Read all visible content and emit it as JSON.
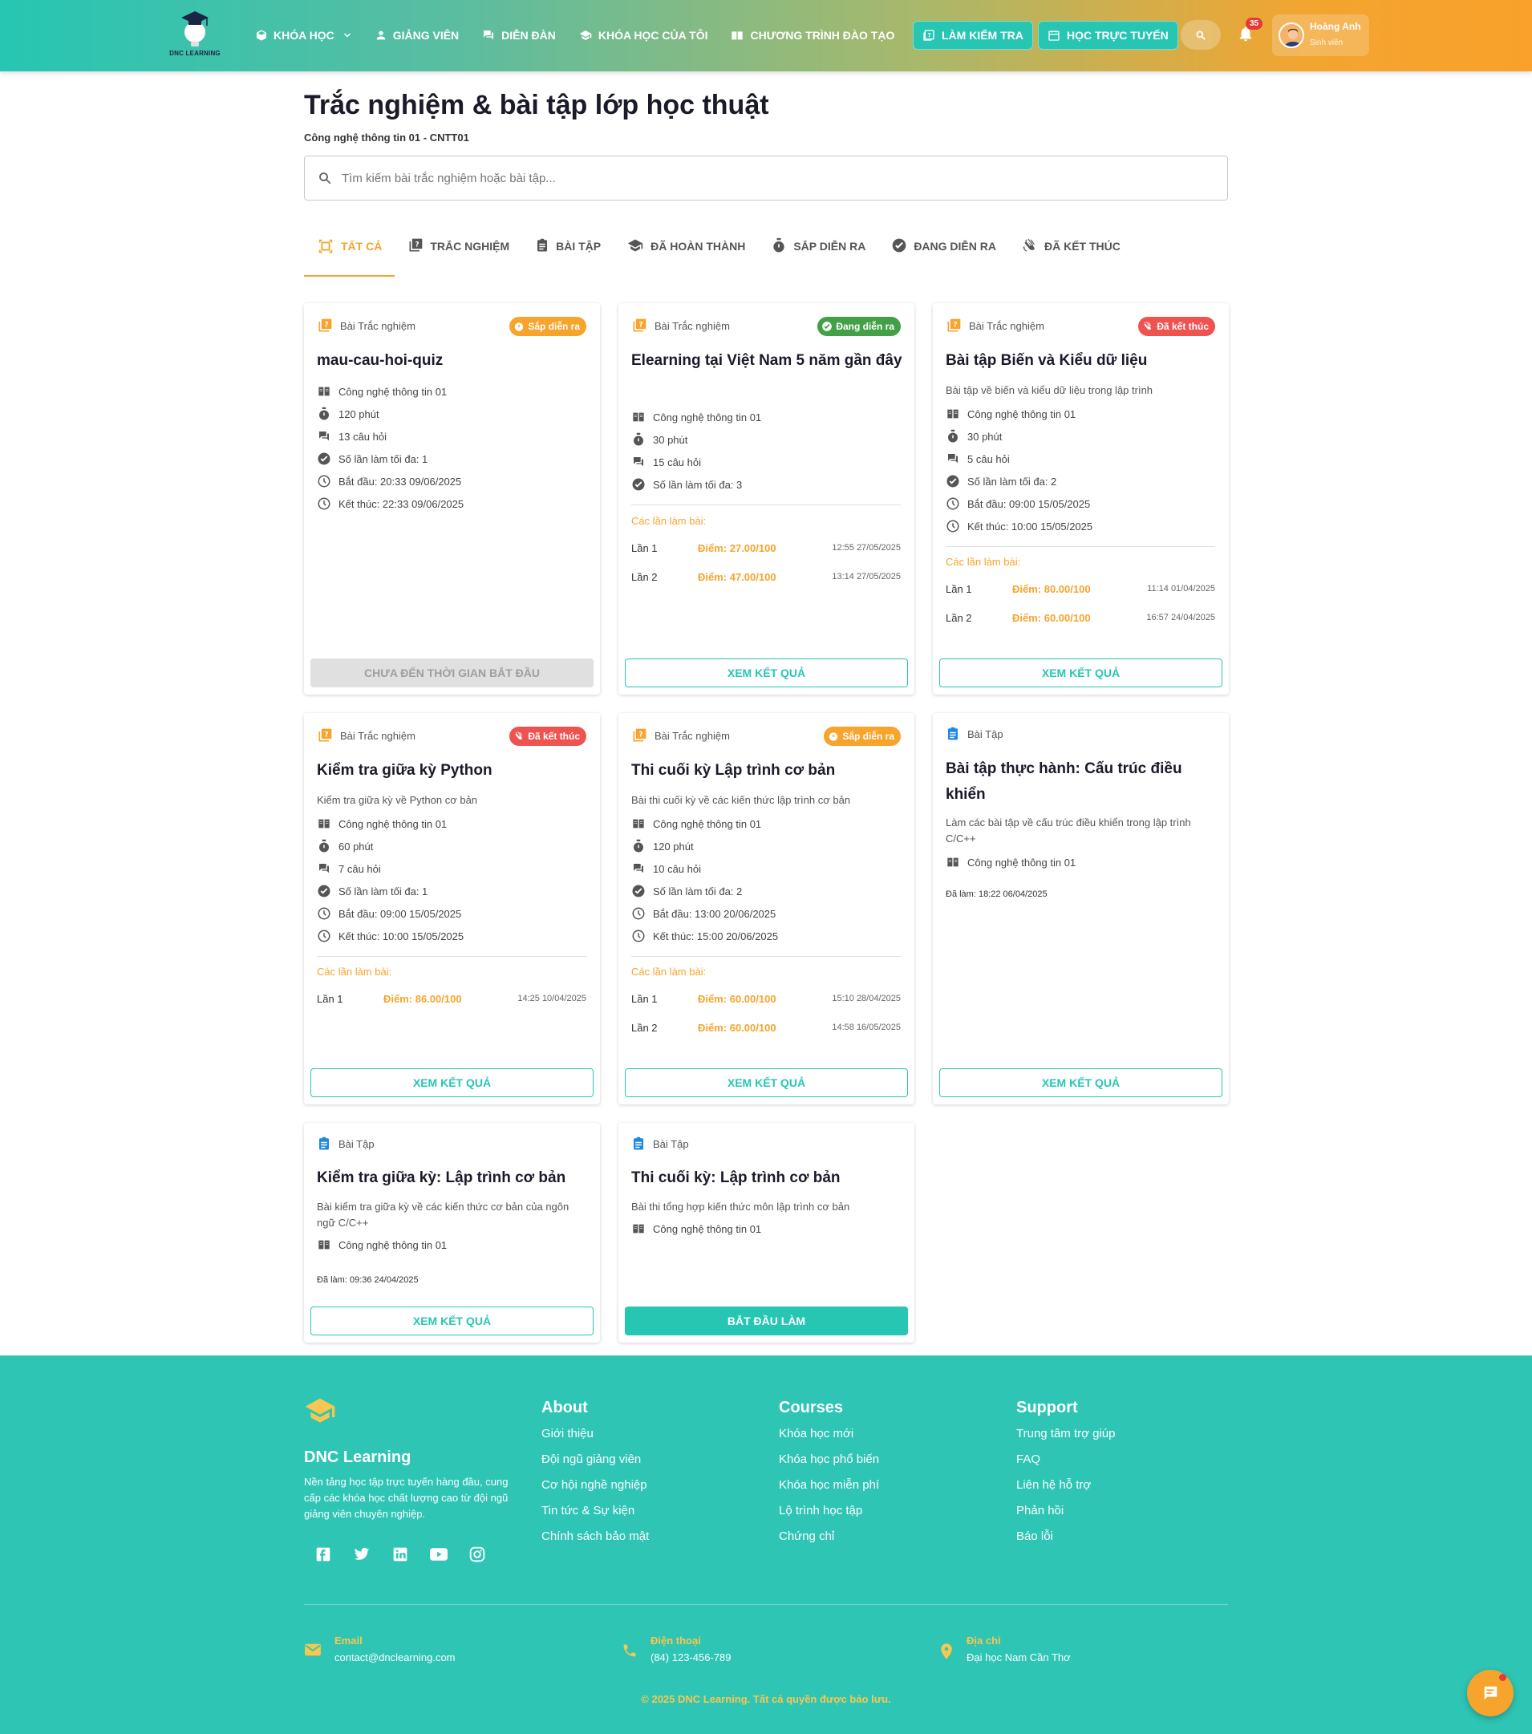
{
  "header": {
    "logo_text": "DNC LEARNING",
    "nav": [
      {
        "label": "KHÓA HỌC",
        "icon": "box-icon"
      },
      {
        "label": "GIẢNG VIÊN",
        "icon": "person-icon"
      },
      {
        "label": "DIỄN ĐÀN",
        "icon": "forum-icon"
      },
      {
        "label": "KHÓA HỌC CỦA TÔI",
        "icon": "graduation-cap-icon"
      },
      {
        "label": "CHƯƠNG TRÌNH ĐÀO TẠO",
        "icon": "book-icon"
      }
    ],
    "btn_test": "LÀM KIỂM TRA",
    "btn_online": "HỌC TRỰC TUYẾN",
    "notif_count": "35",
    "user_name": "Hoàng Anh",
    "user_role": "Sinh viên"
  },
  "page": {
    "title": "Trắc nghiệm & bài tập lớp học thuật",
    "subtitle": "Công nghệ thông tin 01 - CNTT01",
    "search_placeholder": "Tìm kiếm bài trắc nghiệm hoặc bài tập..."
  },
  "tabs": [
    {
      "label": "TẤT CẢ",
      "icon": "select-all-icon",
      "active": true
    },
    {
      "label": "TRẮC NGHIỆM",
      "icon": "quiz-icon"
    },
    {
      "label": "BÀI TẬP",
      "icon": "assignment-icon"
    },
    {
      "label": "ĐÃ HOÀN THÀNH",
      "icon": "graduation-cap-icon"
    },
    {
      "label": "SẮP DIỄN RA",
      "icon": "timer-icon"
    },
    {
      "label": "ĐANG DIỄN RA",
      "icon": "check-circle-icon"
    },
    {
      "label": "ĐÃ KẾT THÚC",
      "icon": "hand-wave-icon"
    }
  ],
  "cards": [
    {
      "type": "Bài Trắc nghiệm",
      "badge": "Sắp diễn ra",
      "title": "mau-cau-hoi-quiz",
      "course": "Công nghệ thông tin 01",
      "duration": "120 phút",
      "questions": "13 câu hỏi",
      "max_attempts": "Số lần làm tối đa: 1",
      "start": "Bắt đầu: 20:33 09/06/2025",
      "end": "Kết thúc: 22:33 09/06/2025",
      "button": "CHƯA ĐẾN THỜI GIAN BẮT ĐẦU"
    },
    {
      "type": "Bài Trắc nghiệm",
      "badge": "Đang diễn ra",
      "title": "Elearning tại Việt Nam 5 năm gần đây",
      "course": "Công nghệ thông tin 01",
      "duration": "30 phút",
      "questions": "15 câu hỏi",
      "max_attempts": "Số lần làm tối đa: 3",
      "attempts_label": "Các lần làm bài:",
      "attempts": [
        {
          "n": "Lần 1",
          "score": "Điểm: 27.00/100",
          "time": "12:55 27/05/2025"
        },
        {
          "n": "Lần 2",
          "score": "Điểm: 47.00/100",
          "time": "13:14 27/05/2025"
        }
      ],
      "button": "XEM KẾT QUẢ"
    },
    {
      "type": "Bài Trắc nghiệm",
      "badge": "Đã kết thúc",
      "title": "Bài tập Biến và Kiểu dữ liệu",
      "desc": "Bài tập về biến và kiểu dữ liệu trong lập trình",
      "course": "Công nghệ thông tin 01",
      "duration": "30 phút",
      "questions": "5 câu hỏi",
      "max_attempts": "Số lần làm tối đa: 2",
      "start": "Bắt đầu: 09:00 15/05/2025",
      "end": "Kết thúc: 10:00 15/05/2025",
      "attempts_label": "Các lần làm bài:",
      "attempts": [
        {
          "n": "Lần 1",
          "score": "Điểm: 80.00/100",
          "time": "11:14 01/04/2025"
        },
        {
          "n": "Lần 2",
          "score": "Điểm: 60.00/100",
          "time": "16:57 24/04/2025"
        }
      ],
      "button": "XEM KẾT QUẢ"
    },
    {
      "type": "Bài Trắc nghiệm",
      "badge": "Đã kết thúc",
      "title": "Kiểm tra giữa kỳ Python",
      "desc": "Kiểm tra giữa kỳ về Python cơ bản",
      "course": "Công nghệ thông tin 01",
      "duration": "60 phút",
      "questions": "7 câu hỏi",
      "max_attempts": "Số lần làm tối đa: 1",
      "start": "Bắt đầu: 09:00 15/05/2025",
      "end": "Kết thúc: 10:00 15/05/2025",
      "attempts_label": "Các lần làm bài:",
      "attempts": [
        {
          "n": "Lần 1",
          "score": "Điểm: 86.00/100",
          "time": "14:25 10/04/2025"
        }
      ],
      "button": "XEM KẾT QUẢ"
    },
    {
      "type": "Bài Trắc nghiệm",
      "badge": "Sắp diễn ra",
      "title": "Thi cuối kỳ Lập trình cơ bản",
      "desc": "Bài thi cuối kỳ về các kiến thức lập trình cơ bản",
      "course": "Công nghệ thông tin 01",
      "duration": "120 phút",
      "questions": "10 câu hỏi",
      "max_attempts": "Số lần làm tối đa: 2",
      "start": "Bắt đầu: 13:00 20/06/2025",
      "end": "Kết thúc: 15:00 20/06/2025",
      "attempts_label": "Các lần làm bài:",
      "attempts": [
        {
          "n": "Lần 1",
          "score": "Điểm: 60.00/100",
          "time": "15:10 28/04/2025"
        },
        {
          "n": "Lần 2",
          "score": "Điểm: 60.00/100",
          "time": "14:58 16/05/2025"
        }
      ],
      "button": "XEM KẾT QUẢ"
    },
    {
      "type": "Bài Tập",
      "title": "Bài tập thực hành: Cấu trúc điều khiển",
      "desc": "Làm các bài tập về cấu trúc điều khiển trong lập trình C/C++",
      "course": "Công nghệ thông tin 01",
      "done_at": "Đã làm: 18:22 06/04/2025",
      "button": "XEM KẾT QUẢ"
    },
    {
      "type": "Bài Tập",
      "title": "Kiểm tra giữa kỳ: Lập trình cơ bản",
      "desc": "Bài kiểm tra giữa kỳ về các kiến thức cơ bản của ngôn ngữ C/C++",
      "course": "Công nghệ thông tin 01",
      "done_at": "Đã làm: 09:36 24/04/2025",
      "button": "XEM KẾT QUẢ"
    },
    {
      "type": "Bài Tập",
      "title": "Thi cuối kỳ: Lập trình cơ bản",
      "desc": "Bài thi tổng hợp kiến thức môn lập trình cơ bản",
      "course": "Công nghệ thông tin 01",
      "button": "BẮT ĐẦU LÀM"
    }
  ],
  "footer": {
    "brand": "DNC Learning",
    "desc": "Nền tảng học tập trực tuyến hàng đầu, cung cấp các khóa học chất lượng cao từ đội ngũ giảng viên chuyên nghiệp.",
    "about": {
      "title": "About",
      "links": [
        "Giới thiệu",
        "Đội ngũ giảng viên",
        "Cơ hội nghề nghiệp",
        "Tin tức & Sự kiện",
        "Chính sách bảo mật"
      ]
    },
    "courses": {
      "title": "Courses",
      "links": [
        "Khóa học mới",
        "Khóa học phổ biến",
        "Khóa học miễn phí",
        "Lộ trình học tập",
        "Chứng chỉ"
      ]
    },
    "support": {
      "title": "Support",
      "links": [
        "Trung tâm trợ giúp",
        "FAQ",
        "Liên hệ hỗ trợ",
        "Phản hồi",
        "Báo lỗi"
      ]
    },
    "email_label": "Email",
    "email": "contact@dnclearning.com",
    "phone_label": "Điện thoại",
    "phone": "(84) 123-456-789",
    "address_label": "Địa chỉ",
    "address": "Đại học Nam Cần Thơ",
    "copyright": "© 2025 DNC Learning. Tất cả quyền được bảo lưu."
  },
  "colors": {
    "primary": "#26c6b3",
    "accent": "#f7a42c",
    "ongoing": "#43a047",
    "ended": "#ef5350"
  }
}
